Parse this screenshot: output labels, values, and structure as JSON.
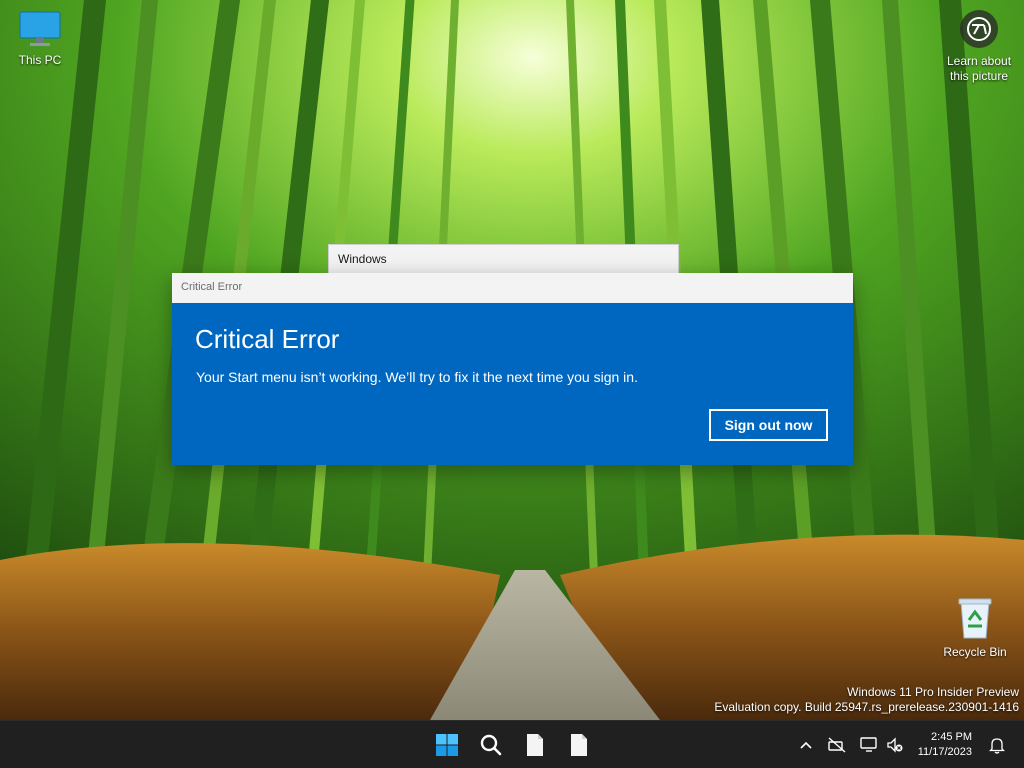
{
  "desktop": {
    "this_pc_label": "This PC",
    "recycle_bin_label": "Recycle Bin",
    "learn_line1": "Learn about",
    "learn_line2": "this picture"
  },
  "back_window": {
    "title": "Windows"
  },
  "dialog": {
    "window_title": "Critical Error",
    "heading": "Critical Error",
    "message": "Your Start menu isn’t working. We’ll try to fix it the next time you sign in.",
    "button_label": "Sign out now"
  },
  "watermark": {
    "line1": "Windows 11 Pro Insider Preview",
    "line2": "Evaluation copy. Build 25947.rs_prerelease.230901-1416"
  },
  "taskbar": {
    "pinned": [
      "start-icon",
      "search-icon",
      "file-icon",
      "file-icon"
    ],
    "tray_icons": [
      "chevron-up-icon",
      "network-off-icon",
      "display-icon",
      "volume-icon",
      "notification-icon"
    ],
    "time": "2:45 PM",
    "date": "11/17/2023"
  },
  "colors": {
    "dialog_blue": "#0067c0",
    "taskbar": "#202020",
    "start_blue": "#4cc2ff"
  }
}
